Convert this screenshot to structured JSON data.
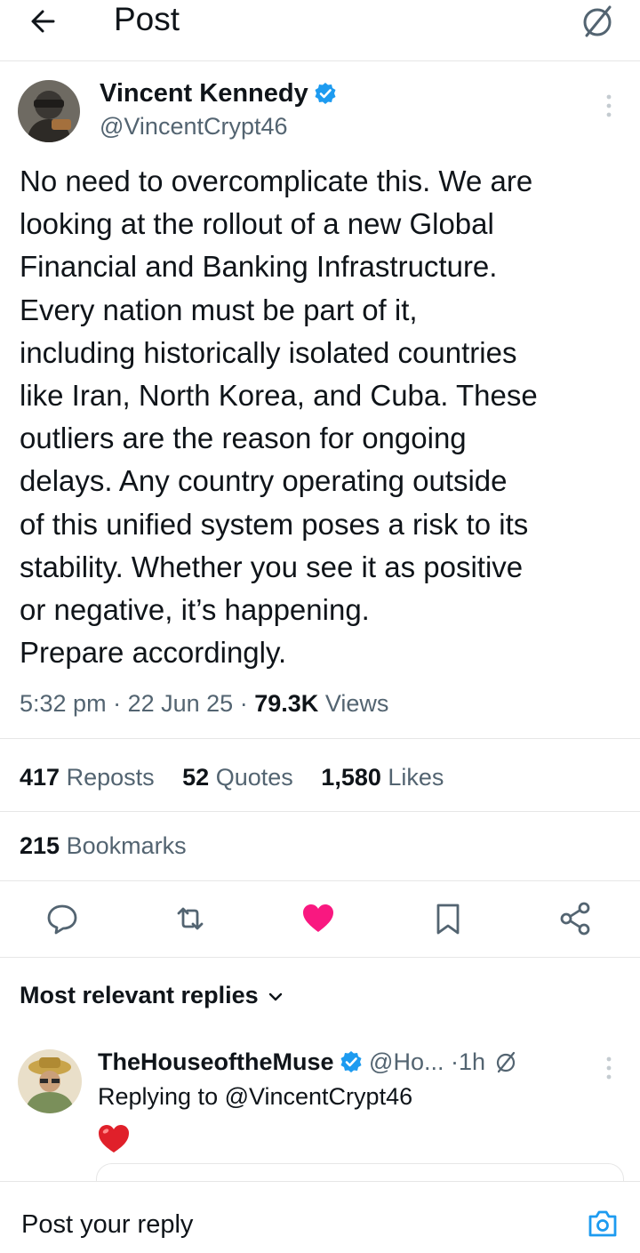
{
  "header": {
    "title": "Post",
    "back_icon": "arrow-left-icon",
    "grok_icon": "grok-icon"
  },
  "post": {
    "author_name": "Vincent Kennedy",
    "author_handle": "@VincentCrypt46",
    "verified": true,
    "body": "No need to overcomplicate this. We are\nlooking at the rollout of a new Global\nFinancial and Banking Infrastructure.\nEvery nation must be part of it,\nincluding historically isolated countries\nlike Iran, North Korea, and Cuba. These\noutliers are the reason for ongoing\ndelays. Any country operating outside\nof this unified system poses a risk to its\nstability. Whether you see it as positive\nor negative, it’s happening.\nPrepare accordingly.",
    "time": "5:32 pm",
    "date": "22 Jun 25",
    "sep": "·",
    "views_count": "79.3K",
    "views_label": "Views"
  },
  "stats": {
    "reposts_count": "417",
    "reposts_label": "Reposts",
    "quotes_count": "52",
    "quotes_label": "Quotes",
    "likes_count": "1,580",
    "likes_label": "Likes",
    "bookmarks_count": "215",
    "bookmarks_label": "Bookmarks"
  },
  "actions": [
    "reply-icon",
    "repost-icon",
    "like-icon",
    "bookmark-icon",
    "share-icon"
  ],
  "replies_section": {
    "title": "Most relevant replies"
  },
  "reply": {
    "author_name": "TheHouseoftheMuse",
    "handle": "@Ho...",
    "sep": "·",
    "time": "1h",
    "replying_to": "Replying to @VincentCrypt46",
    "emoji": "heart-emoji"
  },
  "composer": {
    "placeholder": "Post your reply",
    "camera_icon": "camera-icon"
  },
  "colors": {
    "verified_blue": "#1d9bf0",
    "like_pink": "#f91880",
    "text_primary": "#0f1419",
    "text_secondary": "#536471",
    "divider": "#e6e6e6"
  }
}
